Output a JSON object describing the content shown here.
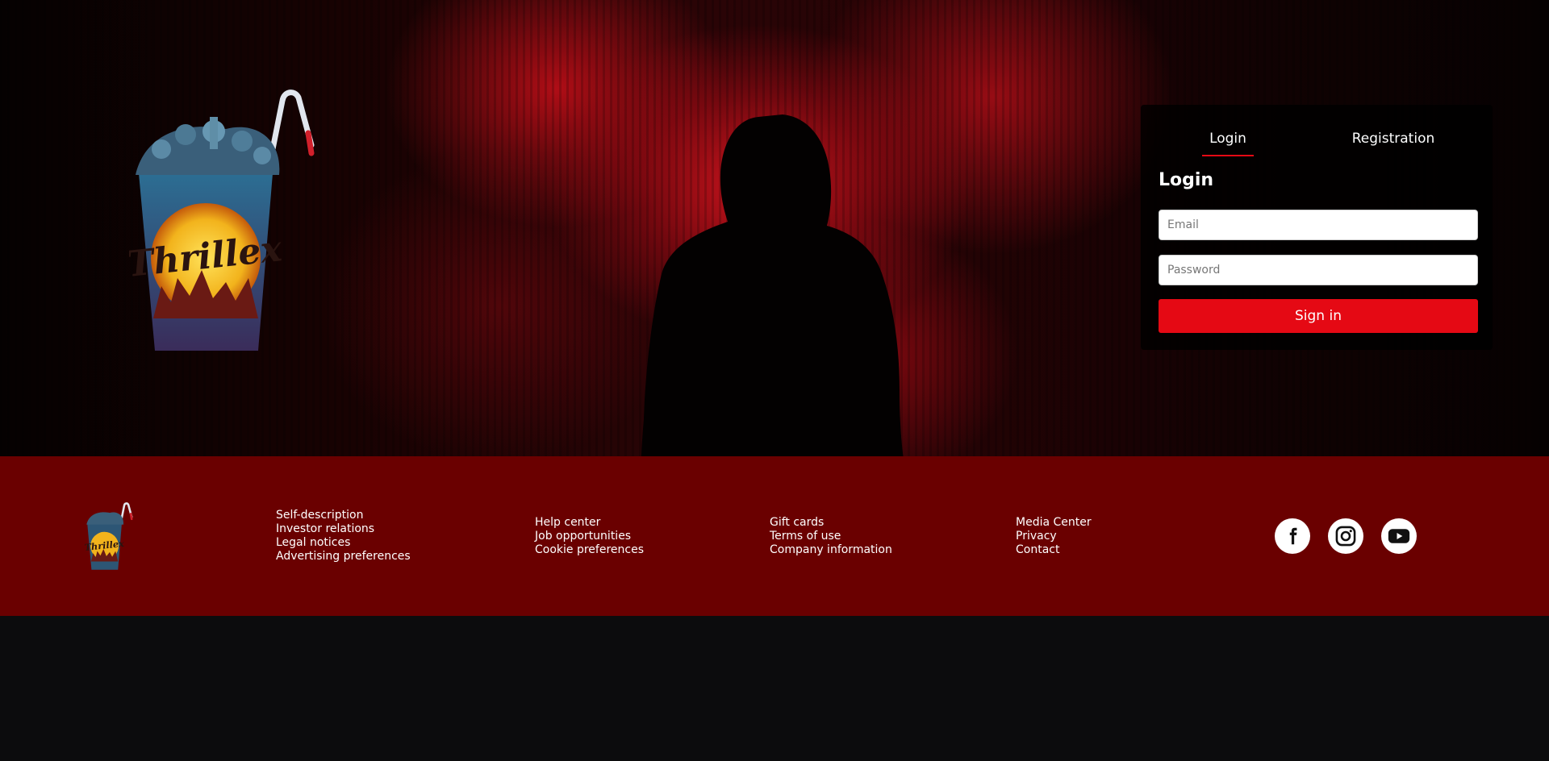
{
  "brand": {
    "name": "Thrillex"
  },
  "login_card": {
    "tabs": [
      {
        "label": "Login",
        "active": true
      },
      {
        "label": "Registration",
        "active": false
      }
    ],
    "heading": "Login",
    "email_placeholder": "Email",
    "password_placeholder": "Password",
    "signin_label": "Sign in"
  },
  "footer": {
    "columns": [
      {
        "links": [
          "Self-description",
          "Investor relations",
          "Legal notices",
          "Advertising preferences"
        ]
      },
      {
        "links": [
          "Help center",
          "Job opportunities",
          "Cookie preferences"
        ]
      },
      {
        "links": [
          "Gift cards",
          "Terms of use",
          "Company information"
        ]
      },
      {
        "links": [
          "Media Center",
          "Privacy",
          "Contact"
        ]
      }
    ],
    "social": [
      {
        "name": "facebook-icon"
      },
      {
        "name": "instagram-icon"
      },
      {
        "name": "youtube-icon"
      }
    ]
  },
  "colors": {
    "accent": "#e50914",
    "footer_bg": "#6a0000",
    "page_bg": "#0c0c0d"
  }
}
